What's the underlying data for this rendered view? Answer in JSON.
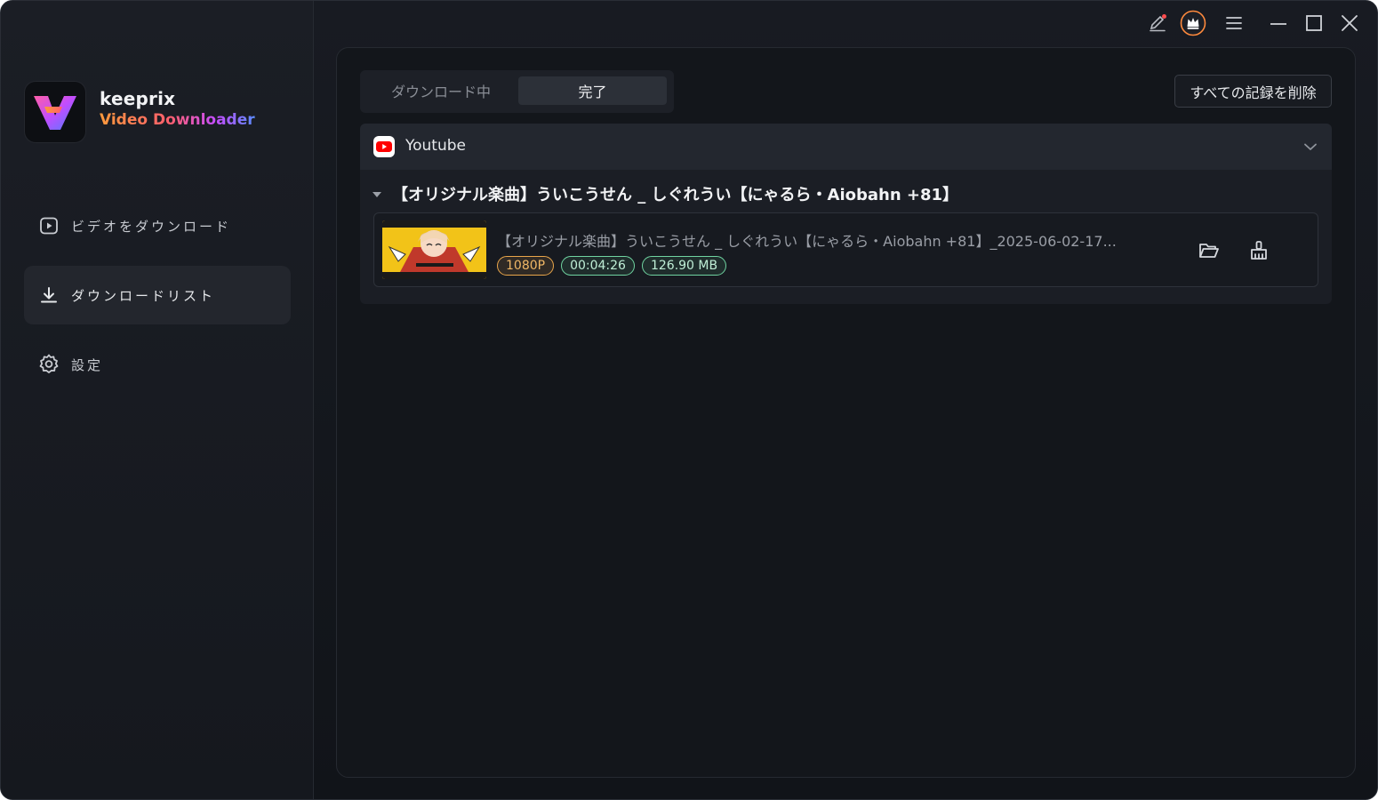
{
  "app": {
    "brand_name": "keeprix",
    "brand_sub": "Video Downloader"
  },
  "sidebar": {
    "items": [
      {
        "label": "ビデオをダウンロード",
        "icon": "play-square-icon",
        "active": false
      },
      {
        "label": "ダウンロードリスト",
        "icon": "download-icon",
        "active": true
      },
      {
        "label": "設定",
        "icon": "gear-icon",
        "active": false
      }
    ]
  },
  "titlebar": {
    "icons": [
      "feedback-pen-icon",
      "premium-crown-icon",
      "menu-icon",
      "minimize-icon",
      "maximize-icon",
      "close-icon"
    ]
  },
  "main": {
    "tabs": [
      {
        "label": "ダウンロード中",
        "active": false
      },
      {
        "label": "完了",
        "active": true
      }
    ],
    "clear_all_label": "すべての記録を削除",
    "group": {
      "source": "Youtube",
      "source_icon": "youtube-icon",
      "item_title": "【オリジナル楽曲】ういこうせん _ しぐれうい【にゃるら・Aiobahn +81】",
      "file": {
        "name": "【オリジナル楽曲】ういこうせん _ しぐれうい【にゃるら・Aiobahn +81】_2025-06-02-17...",
        "resolution": "1080P",
        "duration": "00:04:26",
        "size": "126.90 MB",
        "actions": [
          "open-folder-icon",
          "clean-broom-icon"
        ]
      }
    }
  },
  "colors": {
    "bg": "#13161b",
    "sidebar_bg": "#1b1e25",
    "resolution_badge": "#e8a54a",
    "info_badge": "#6fd3a0",
    "youtube_red": "#ff0000"
  }
}
